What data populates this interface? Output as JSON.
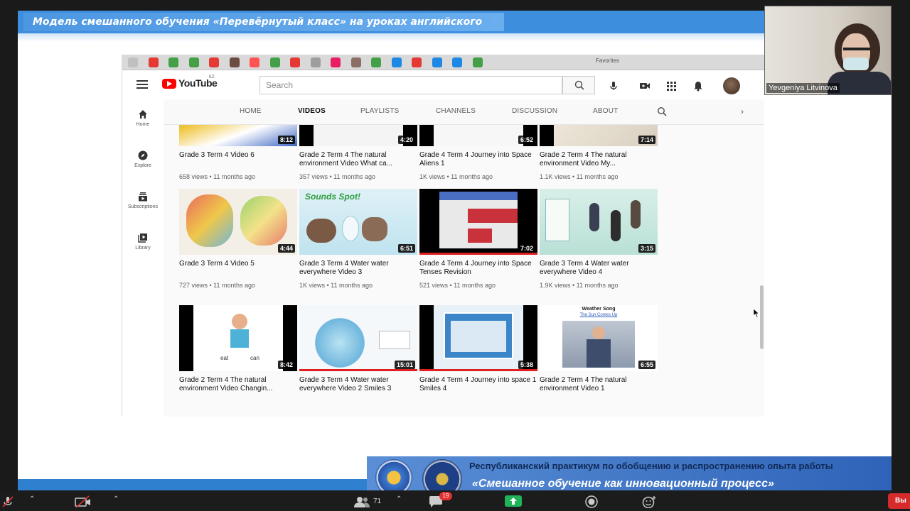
{
  "slide": {
    "title": "Модель смешанного обучения «Перевёрнутый класс» на уроках английского языка",
    "banner_line1": "Республиканский практикум по обобщению и распространению опыта работы",
    "banner_line2": "«Смешанное обучение как инновационный процесс»"
  },
  "browser": {
    "favorites_label": "Favorites",
    "bookmark_colors": [
      "#c0c0c0",
      "#e53935",
      "#43a047",
      "#43a047",
      "#e53935",
      "#6d4c41",
      "#ff5252",
      "#43a047",
      "#e53935",
      "#9e9e9e",
      "#e91e63",
      "#8d6e63",
      "#43a047",
      "#1e88e5",
      "#e53935",
      "#1e88e5",
      "#1e88e5",
      "#43a047"
    ]
  },
  "youtube": {
    "logo_text": "YouTube",
    "region": "KZ",
    "search_placeholder": "Search",
    "sidebar": [
      {
        "label": "Home",
        "icon": "home-icon"
      },
      {
        "label": "Explore",
        "icon": "compass-icon"
      },
      {
        "label": "Subscriptions",
        "icon": "subscriptions-icon"
      },
      {
        "label": "Library",
        "icon": "library-icon"
      }
    ],
    "tabs": [
      "HOME",
      "VIDEOS",
      "PLAYLISTS",
      "CHANNELS",
      "DISCUSSION",
      "ABOUT"
    ],
    "active_tab": "VIDEOS",
    "videos": [
      {
        "title": "Grade 3 Term 4 Video 6",
        "meta": "658 views • 11 months ago",
        "duration": "8:12"
      },
      {
        "title": "Grade 2 Term 4 The natural environment Video What ca...",
        "meta": "357 views • 11 months ago",
        "duration": "4:20"
      },
      {
        "title": "Grade 4 Term 4 Journey into Space Aliens 1",
        "meta": "1K views • 11 months ago",
        "duration": "6:52"
      },
      {
        "title": "Grade 2 Term 4 The natural environment Video My...",
        "meta": "1.1K views • 11 months ago",
        "duration": "7:14"
      },
      {
        "title": "Grade 3 Term 4 Video 5",
        "meta": "727 views • 11 months ago",
        "duration": "4:44"
      },
      {
        "title": "Grade 3 Term 4 Water water everywhere Video 3",
        "meta": "1K views • 11 months ago",
        "duration": "6:51"
      },
      {
        "title": "Grade 4 Term 4 Journey into Space Tenses Revision",
        "meta": "521 views • 11 months ago",
        "duration": "7:02"
      },
      {
        "title": "Grade 3 Term 4 Water water everywhere Video 4",
        "meta": "1.9K views • 11 months ago",
        "duration": "3:15"
      },
      {
        "title": "Grade 2 Term 4 The natural environment Video Changin...",
        "meta": "",
        "duration": "8:42"
      },
      {
        "title": "Grade 3 Term 4 Water water everywhere Video 2 Smiles 3",
        "meta": "",
        "duration": "15:01"
      },
      {
        "title": "Grade 4 Term 4 Journey into space 1 Smiles 4",
        "meta": "",
        "duration": "5:38"
      },
      {
        "title": "Grade 2 Term 4 The natural environment Video 1",
        "meta": "",
        "duration": "6:55"
      }
    ],
    "thumb_texts": {
      "sounds_spot": "Sounds Spot!",
      "weather_song": "Weather Song",
      "sun_comes_up": "The Sun Comes Up",
      "word_eat": "eat",
      "word_can": "can"
    }
  },
  "participant": {
    "name": "Yevgeniya Litvinova"
  },
  "zoom": {
    "participants_count": "71",
    "chat_badge": "19",
    "end_label": "Вы"
  }
}
